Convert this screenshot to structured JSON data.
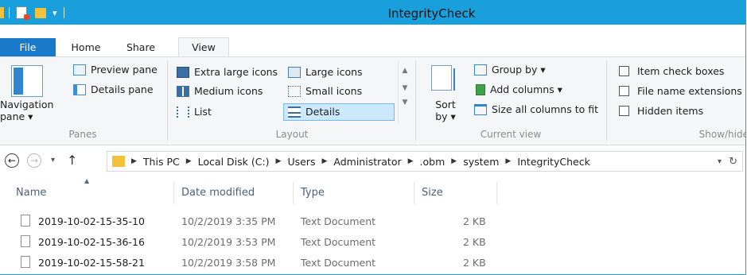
{
  "window": {
    "title": "IntegrityCheck"
  },
  "tabs": {
    "file": "File",
    "home": "Home",
    "share": "Share",
    "view": "View"
  },
  "ribbon": {
    "panes": {
      "navigation_pane": "Navigation pane ▾",
      "preview_pane": "Preview pane",
      "details_pane": "Details pane",
      "group_label": "Panes"
    },
    "layout": {
      "extra_large_icons": "Extra large icons",
      "large_icons": "Large icons",
      "medium_icons": "Medium icons",
      "small_icons": "Small icons",
      "list": "List",
      "details": "Details",
      "group_label": "Layout",
      "selected": "Details"
    },
    "current_view": {
      "sort_by": "Sort by ▾",
      "group_by": "Group by ▾",
      "add_columns": "Add columns ▾",
      "size_all_columns": "Size all columns to fit",
      "group_label": "Current view"
    },
    "show_hide": {
      "item_check_boxes": "Item check boxes",
      "file_name_extensions": "File name extensions",
      "hidden_items": "Hidden items",
      "group_label": "Show/hide"
    }
  },
  "address": {
    "breadcrumbs": [
      "This PC",
      "Local Disk (C:)",
      "Users",
      "Administrator",
      ".obm",
      "system",
      "IntegrityCheck"
    ]
  },
  "files": {
    "columns": [
      "Name",
      "Date modified",
      "Type",
      "Size"
    ],
    "rows": [
      {
        "name": "2019-10-02-15-35-10",
        "date": "10/2/2019 3:35 PM",
        "type": "Text Document",
        "size": "2 KB"
      },
      {
        "name": "2019-10-02-15-36-16",
        "date": "10/2/2019 3:53 PM",
        "type": "Text Document",
        "size": "2 KB"
      },
      {
        "name": "2019-10-02-15-58-21",
        "date": "10/2/2019 3:58 PM",
        "type": "Text Document",
        "size": "2 KB"
      }
    ]
  },
  "colors": {
    "accent": "#19a0dc",
    "file_tab": "#1979ca",
    "selection": "#cce8fb"
  }
}
